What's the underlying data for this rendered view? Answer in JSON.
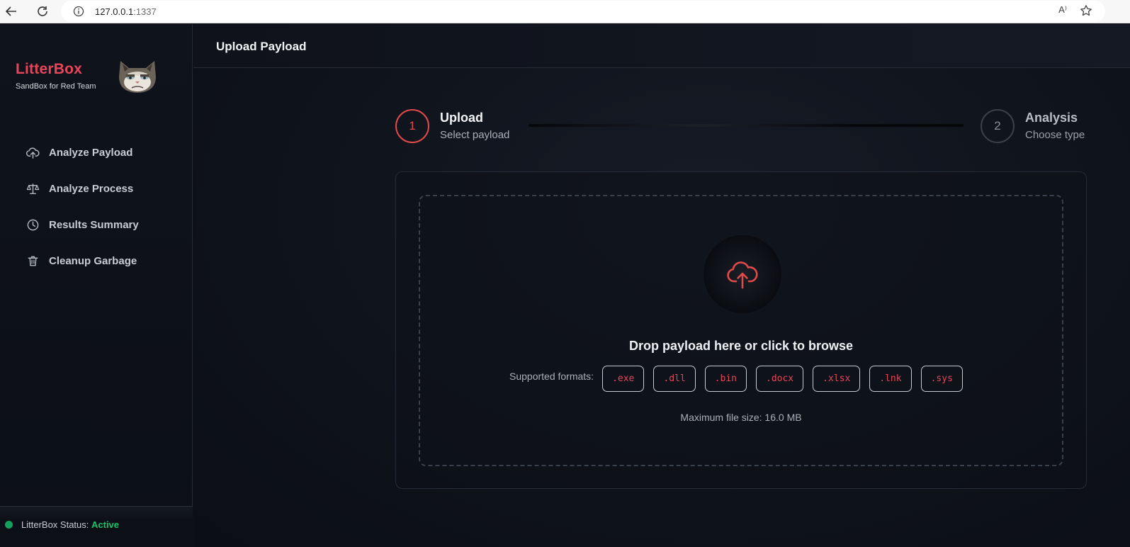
{
  "browser": {
    "url_host": "127.0.0.1",
    "url_port": ":1337",
    "read_aloud": "A⁾"
  },
  "sidebar": {
    "brand_name": "LitterBox",
    "brand_tagline": "SandBox for Red Team",
    "items": [
      {
        "label": "Analyze Payload",
        "icon": "cloud-upload-icon"
      },
      {
        "label": "Analyze Process",
        "icon": "scale-icon"
      },
      {
        "label": "Results Summary",
        "icon": "clock-icon"
      },
      {
        "label": "Cleanup Garbage",
        "icon": "trash-icon"
      }
    ],
    "status_label": "LitterBox Status: ",
    "status_value": "Active"
  },
  "header": {
    "title": "Upload Payload"
  },
  "stepper": {
    "steps": [
      {
        "number": "1",
        "title": "Upload",
        "subtitle": "Select payload",
        "state": "active"
      },
      {
        "number": "2",
        "title": "Analysis",
        "subtitle": "Choose type",
        "state": "inactive"
      }
    ]
  },
  "upload": {
    "prompt": "Drop payload here or click to browse",
    "formats_label": "Supported formats:",
    "formats": [
      ".exe",
      ".dll",
      ".bin",
      ".docx",
      ".xlsx",
      ".lnk",
      ".sys"
    ],
    "max_size": "Maximum file size: 16.0 MB"
  },
  "colors": {
    "accent": "#e8455a",
    "status_ok": "#19c26d"
  }
}
